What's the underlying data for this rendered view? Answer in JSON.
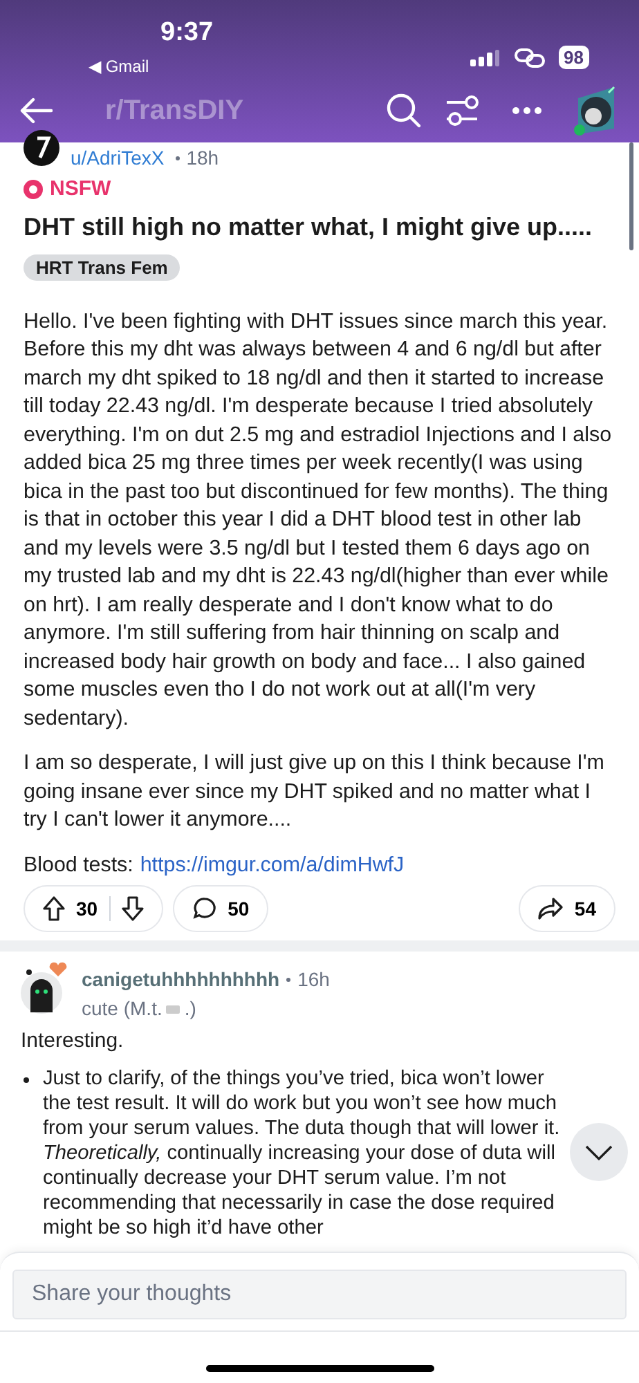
{
  "status_bar": {
    "time": "9:37",
    "back_app": "◀ Gmail",
    "battery": "98"
  },
  "nav": {
    "subreddit": "r/TransDIY"
  },
  "post": {
    "author": "u/AdriTexX",
    "age": "18h",
    "nsfw_label": "NSFW",
    "title": "DHT still high no matter what, I might give up.....",
    "flair": "HRT Trans Fem",
    "paragraphs": [
      "Hello. I've been fighting with DHT issues since march this year. Before this my dht was always between 4 and 6 ng/dl but after march my dht spiked to 18 ng/dl and then it started to increase till today 22.43 ng/dl. I'm desperate because I tried absolutely everything. I'm on dut 2.5 mg and estradiol Injections and I also added bica 25 mg three times per week recently(I was using bica in the past too but discontinued for few months). The thing is that in october this year I did a DHT blood test in other lab and my levels were 3.5 ng/dl but I tested them 6 days ago on my trusted lab and my dht is 22.43 ng/dl(higher than ever while on hrt). I am really desperate and I don't know what to do anymore. I'm still suffering from hair thinning on scalp and increased body hair growth on body and face... I also gained some muscles even tho I do not work out at all(I'm very sedentary).",
      "I am so desperate, I will just give up on this I think because I'm going insane ever since my DHT spiked and no matter what I try I can't lower it anymore...."
    ],
    "link_label": "Blood tests:",
    "link": "https://imgur.com/a/dimHwfJ",
    "votes": "30",
    "comments": "50",
    "shares": "54"
  },
  "comment": {
    "author": "canigetuhhhhhhhhhh",
    "age": "16h",
    "flair_start": "cute (M.t.",
    "flair_end": ".)",
    "intro": "Interesting.",
    "bullets": [
      "Just to clarify, of the things you’ve tried, bica won’t lower the test result. It will do work but you won’t see how much from your serum values. The duta though that will lower it. *Theoretically,* continually increasing your dose of duta will continually decrease your DHT serum value. I’m not recommending that necessarily in case the dose required might be so high it’d have other"
    ]
  },
  "reply_box": {
    "placeholder": "Share your thoughts"
  }
}
